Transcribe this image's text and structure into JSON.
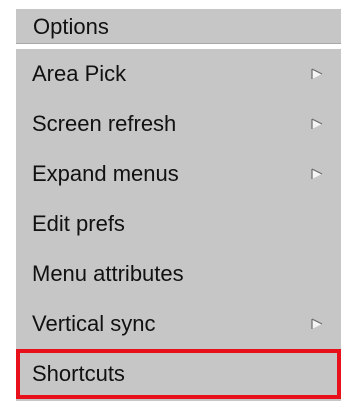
{
  "menu": {
    "title": "Options",
    "items": [
      {
        "label": "Area Pick",
        "has_submenu": true
      },
      {
        "label": "Screen refresh",
        "has_submenu": true
      },
      {
        "label": "Expand menus",
        "has_submenu": true
      },
      {
        "label": "Edit prefs",
        "has_submenu": false
      },
      {
        "label": "Menu attributes",
        "has_submenu": false
      },
      {
        "label": "Vertical sync",
        "has_submenu": true
      },
      {
        "label": "Shortcuts",
        "has_submenu": false,
        "highlighted": true
      }
    ]
  },
  "colors": {
    "panel_background": "#c6c6c6",
    "text": "#111111",
    "highlight_border": "#e8101b"
  },
  "icons": {
    "submenu": "submenu-arrow-icon"
  }
}
